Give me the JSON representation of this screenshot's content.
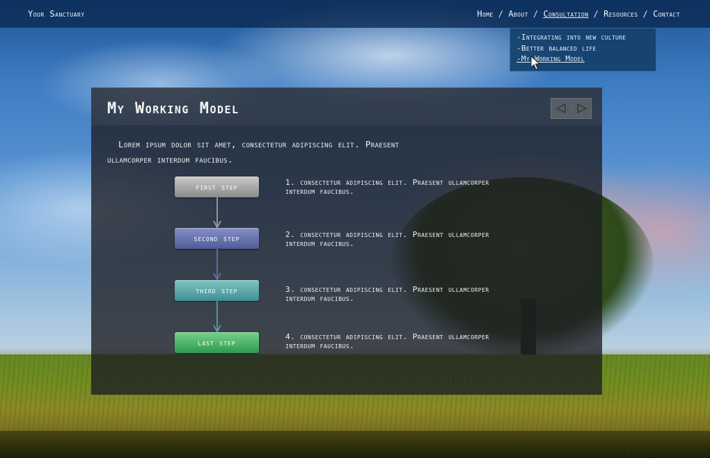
{
  "site": {
    "brand": "Your Sanctuary"
  },
  "nav": {
    "items": [
      {
        "label": "Home"
      },
      {
        "label": "About"
      },
      {
        "label": "Consultation"
      },
      {
        "label": "Resources"
      },
      {
        "label": "Contact"
      }
    ],
    "separator": "/"
  },
  "dropdown": {
    "items": [
      {
        "label": "-Integrating into new culture"
      },
      {
        "label": "-Better balanced life"
      },
      {
        "label": "-My Working Model"
      }
    ]
  },
  "panel": {
    "title": "My Working Model",
    "intro": "Lorem ipsum dolor sit amet, consectetur adipiscing elit. Praesent ullamcorper interdum faucibus.",
    "prev_icon": "left-arrow-icon",
    "next_icon": "right-arrow-icon",
    "steps": [
      {
        "label": "first step",
        "description": "1. consectetur adipiscing elit. Praesent ullamcorper interdum faucibus.",
        "color": "#a9a9a9"
      },
      {
        "label": "second step",
        "description": "2. consectetur adipiscing elit. Praesent ullamcorper interdum faucibus.",
        "color": "#6a76b2"
      },
      {
        "label": "third step",
        "description": "3. consectetur adipiscing elit. Praesent ullamcorper interdum faucibus.",
        "color": "#5eaaa9"
      },
      {
        "label": "last step",
        "description": "4. consectetur adipiscing elit. Praesent ullamcorper interdum faucibus.",
        "color": "#4fb56c"
      }
    ]
  },
  "colors": {
    "topbar": "#0a2850",
    "dropdown": "#123e68",
    "panel": "#1e1e22"
  }
}
